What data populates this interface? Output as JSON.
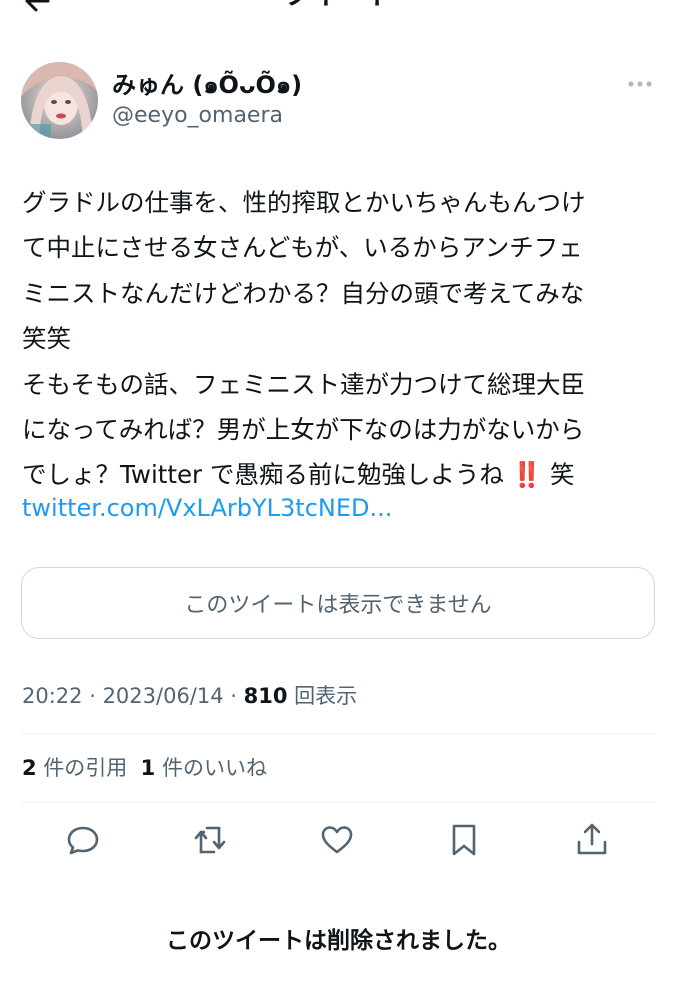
{
  "header": {
    "title": "ツイート",
    "back_icon": "back-arrow-icon"
  },
  "author": {
    "display_name": "みゅん (๑ÕᴗÕ๑)",
    "handle": "@eeyo_omaera",
    "more_icon": "more-dots-icon"
  },
  "tweet": {
    "text": "グラドルの仕事を、性的搾取とかいちゃんもんつけ\nて中止にさせる女さんどもが、いるからアンチフェ\nミニストなんだけどわかる？自分の頭で考えてみな\n笑笑\nそもそもの話、フェミニスト達が力つけて総理大臣\nになってみれば？男が上女が下なのは力がないから\nでしょ？Twitter で愚痴る前に勉強しようね ‼️ 笑",
    "link": "twitter.com/VxLArbYL3tcNED..."
  },
  "quoted": {
    "unavailable_text": "このツイートは表示できません"
  },
  "meta": {
    "time": "20:22",
    "sep1": " · ",
    "date": "2023/06/14",
    "sep2": " · ",
    "views": "810",
    "views_label": " 回表示"
  },
  "stats": {
    "quotes_count": "2",
    "quotes_label": "件の引用",
    "likes_count": "1",
    "likes_label": "件のいいね"
  },
  "actions": [
    "reply-icon",
    "retweet-icon",
    "like-icon",
    "bookmark-icon",
    "share-icon"
  ],
  "footer": {
    "deleted_notice": "このツイートは削除されました。"
  },
  "colors": {
    "link": "#1d9bf0",
    "secondary": "#536471",
    "border": "#cfd9de",
    "text": "#0f1419"
  }
}
